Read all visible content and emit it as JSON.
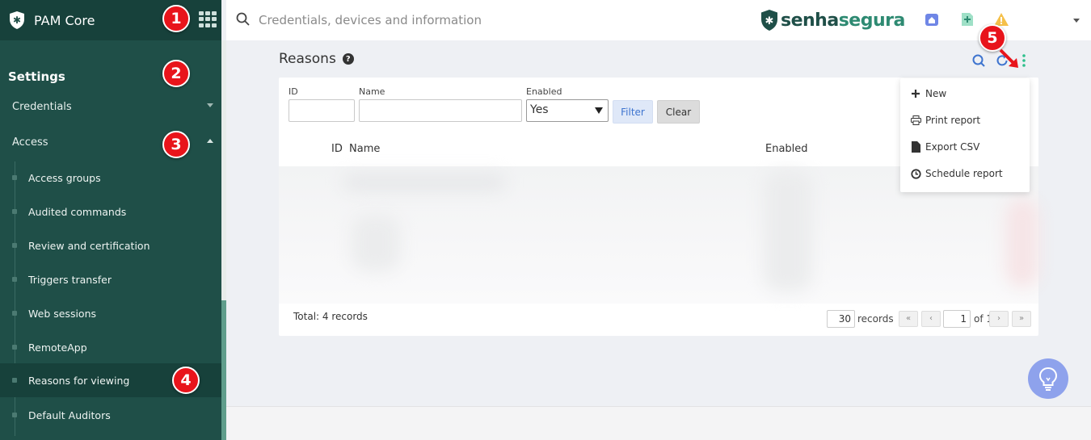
{
  "app": {
    "title": "PAM Core"
  },
  "search": {
    "placeholder": "Credentials, devices and information"
  },
  "brand": {
    "part1": "senha",
    "part2": "segura"
  },
  "sidebar": {
    "heading": "Settings",
    "sections": [
      {
        "label": "Credentials",
        "expanded": false
      },
      {
        "label": "Access",
        "expanded": true
      }
    ],
    "items": [
      {
        "label": "Access groups"
      },
      {
        "label": "Audited commands"
      },
      {
        "label": "Review and certification"
      },
      {
        "label": "Triggers transfer"
      },
      {
        "label": "Web sessions"
      },
      {
        "label": "RemoteApp"
      },
      {
        "label": "Reasons for viewing",
        "active": true
      },
      {
        "label": "Default Auditors"
      }
    ]
  },
  "page": {
    "title": "Reasons"
  },
  "filters": {
    "id_label": "ID",
    "name_label": "Name",
    "enabled_label": "Enabled",
    "enabled_value": "Yes",
    "filter_button": "Filter",
    "clear_button": "Clear"
  },
  "table": {
    "headers": [
      "ID",
      "Name",
      "Enabled"
    ]
  },
  "pagination": {
    "total": "Total: 4 records",
    "per_page": "30",
    "per_page_label": "records",
    "current_page": "1",
    "of_label": "of 1",
    "first": "«",
    "prev": "‹",
    "next": "›",
    "last": "»"
  },
  "menu": {
    "items": [
      {
        "label": "New",
        "icon": "plus-icon"
      },
      {
        "label": "Print report",
        "icon": "printer-icon"
      },
      {
        "label": "Export CSV",
        "icon": "file-icon"
      },
      {
        "label": "Schedule report",
        "icon": "clock-icon"
      }
    ]
  },
  "callouts": [
    "1",
    "2",
    "3",
    "4",
    "5"
  ],
  "colors": {
    "sidebar": "#1f4f48",
    "sidebar_dark": "#17413b",
    "accent": "#2e8a72",
    "callout": "#e8141b",
    "primary_blue": "#3e74cf"
  }
}
